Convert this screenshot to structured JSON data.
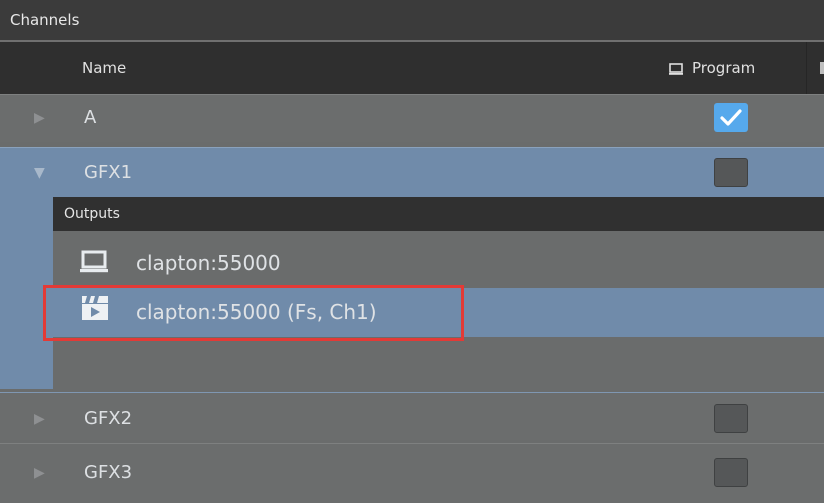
{
  "panel": {
    "title": "Channels"
  },
  "columns": {
    "name": "Name",
    "program": "Program"
  },
  "channels": [
    {
      "name": "A",
      "program_checked": true
    },
    {
      "name": "GFX1",
      "program_checked": false,
      "expanded": true
    },
    {
      "name": "GFX2",
      "program_checked": false
    },
    {
      "name": "GFX3",
      "program_checked": false
    }
  ],
  "outputs": {
    "title": "Outputs",
    "items": [
      {
        "label": "clapton:55000",
        "icon": "monitor-icon"
      },
      {
        "label": "clapton:55000 (Fs, Ch1)",
        "icon": "clapperboard-icon",
        "selected": true
      }
    ]
  },
  "colors": {
    "selection": "#708baa",
    "checkbox_checked": "#56a9ec",
    "highlight_annotation": "#e33a36"
  }
}
